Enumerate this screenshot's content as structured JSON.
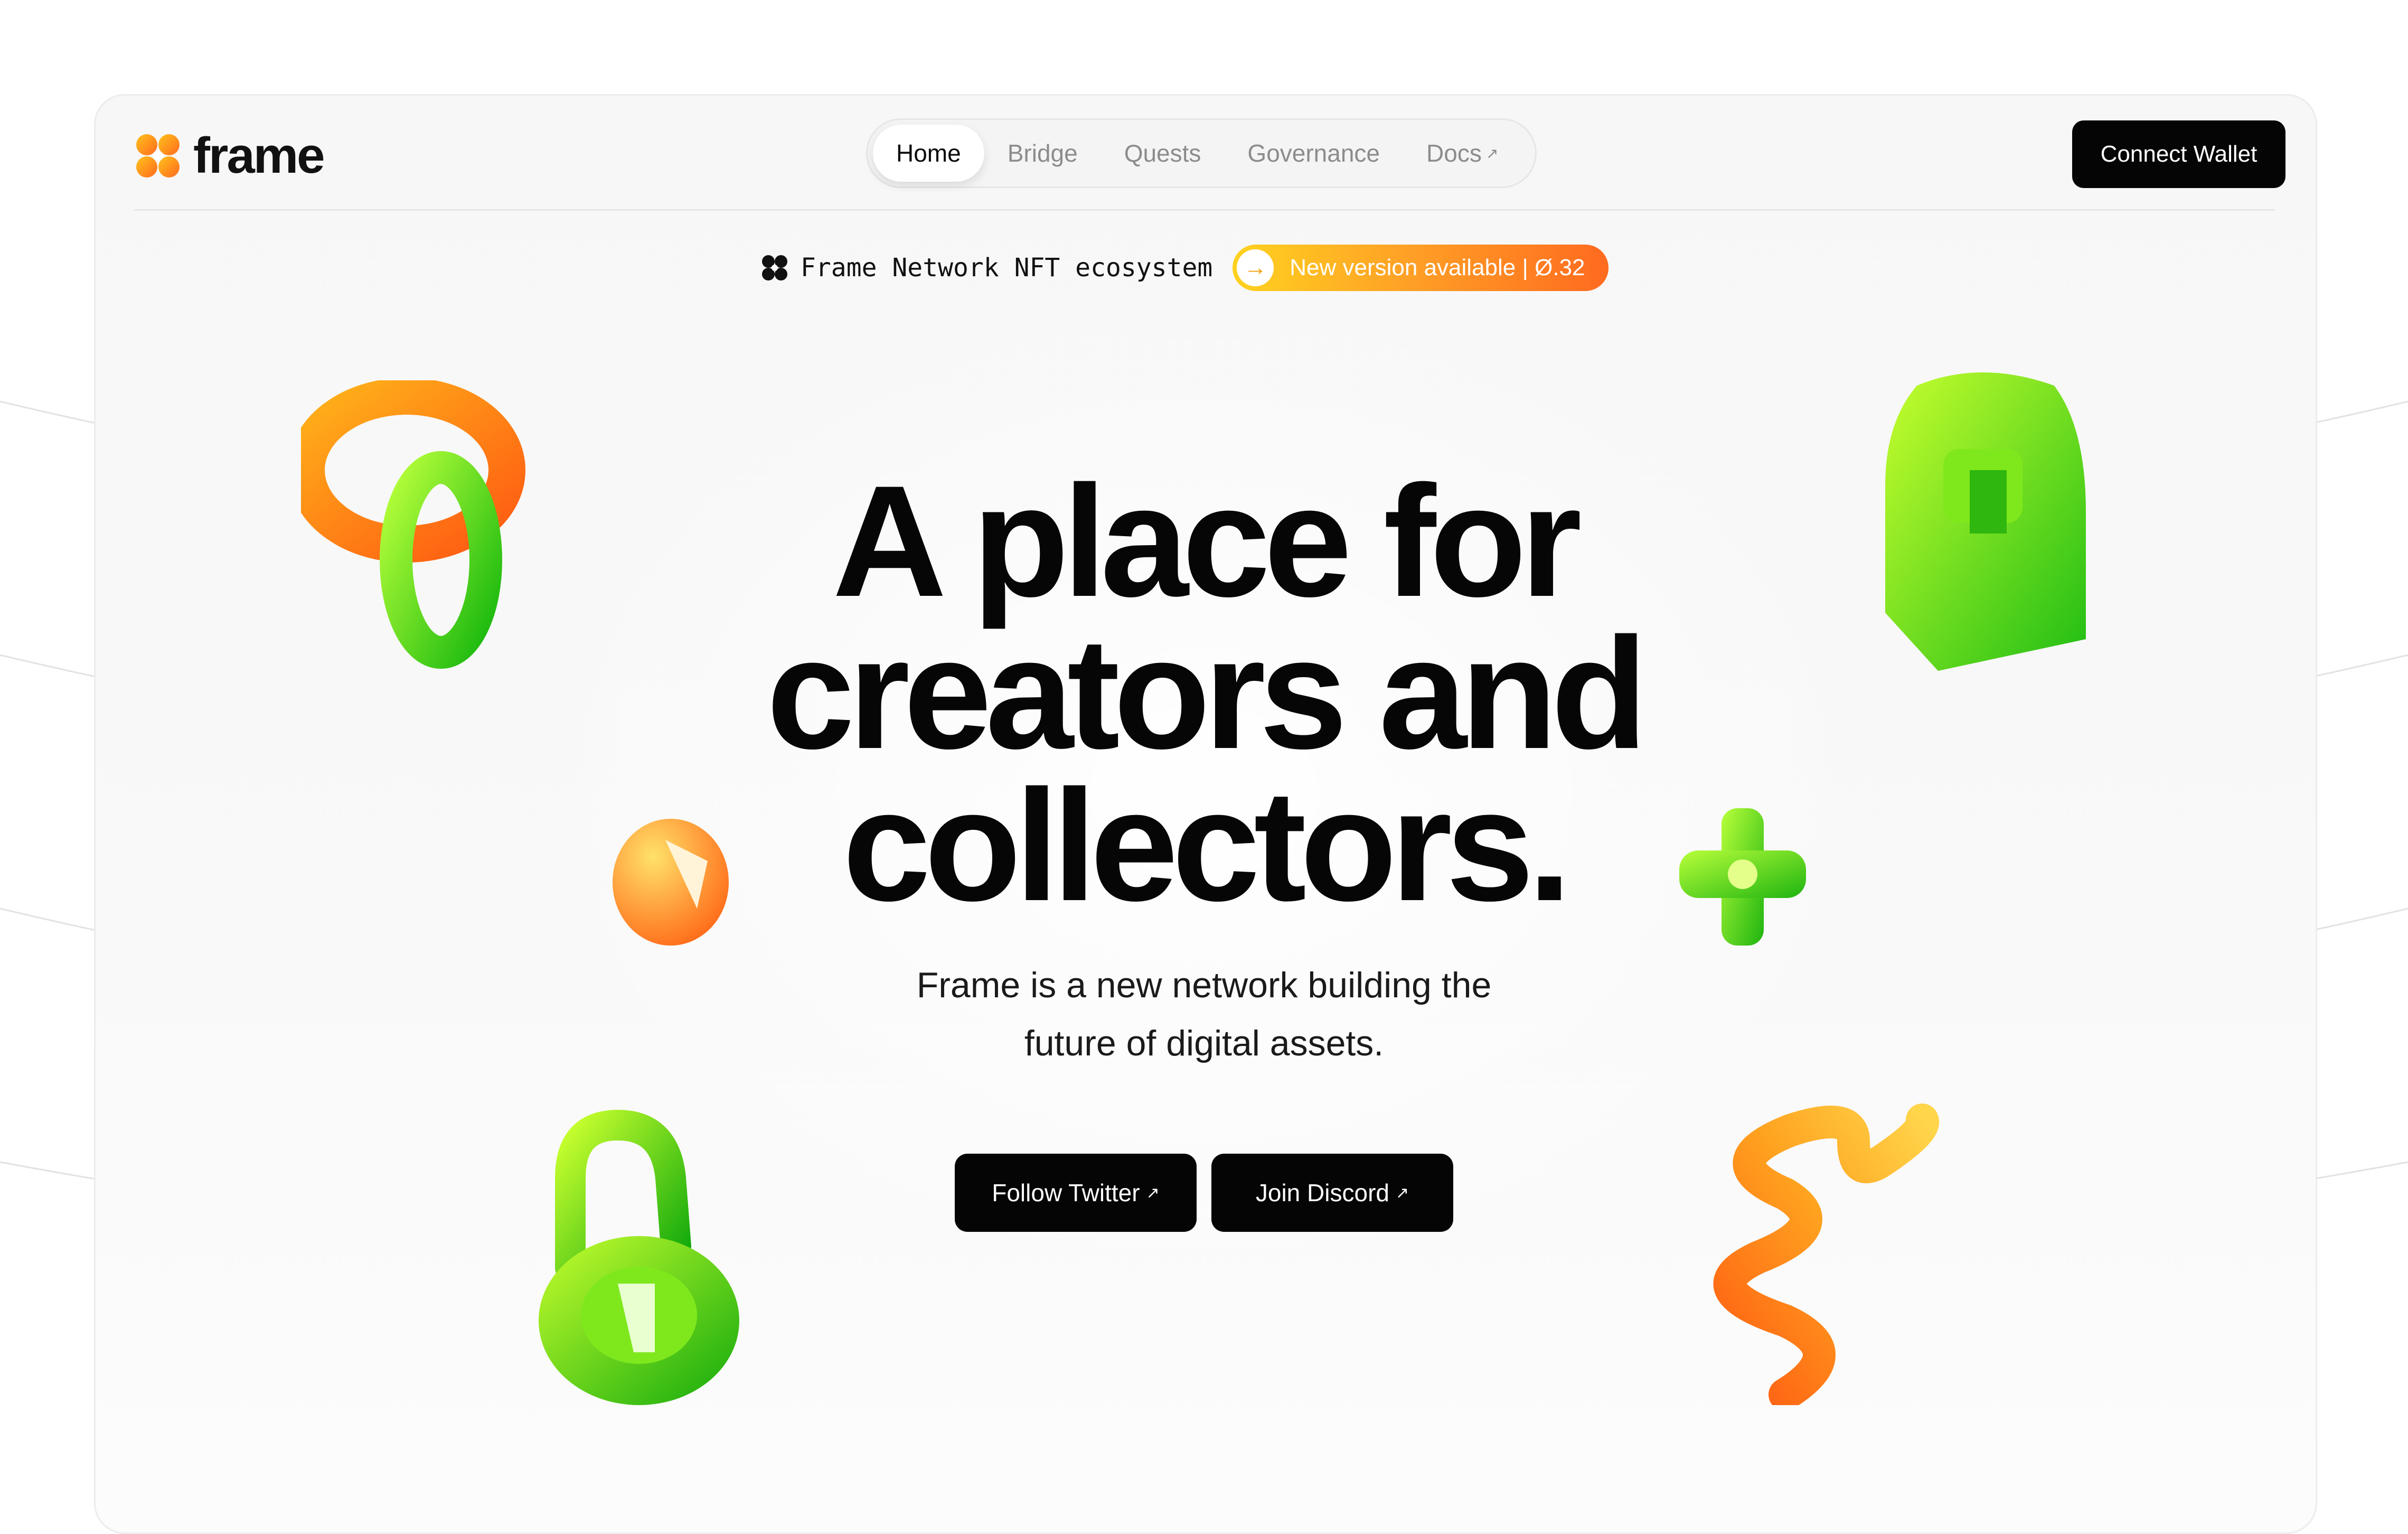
{
  "brand": {
    "name": "frame"
  },
  "nav": {
    "items": [
      {
        "label": "Home",
        "active": true
      },
      {
        "label": "Bridge",
        "active": false
      },
      {
        "label": "Quests",
        "active": false
      },
      {
        "label": "Governance",
        "active": false
      },
      {
        "label": "Docs",
        "active": false,
        "external_icon": "arrow-up-right-icon"
      }
    ]
  },
  "header": {
    "connect_label": "Connect Wallet"
  },
  "announcement": {
    "label": "Frame Network NFT ecosystem",
    "pill_text": "New version available | Ø.32"
  },
  "hero": {
    "title_lines": [
      "A place for",
      "creators and",
      "collectors."
    ],
    "subtitle_lines": [
      "Frame is a new network building the",
      "future of digital assets."
    ]
  },
  "cta": {
    "twitter_label": "Follow Twitter",
    "discord_label": "Join Discord"
  },
  "colors": {
    "accent_orange": "#ff7a1f",
    "accent_yellow": "#ffd21f",
    "accent_green": "#46d81a",
    "button_black": "#050505"
  }
}
